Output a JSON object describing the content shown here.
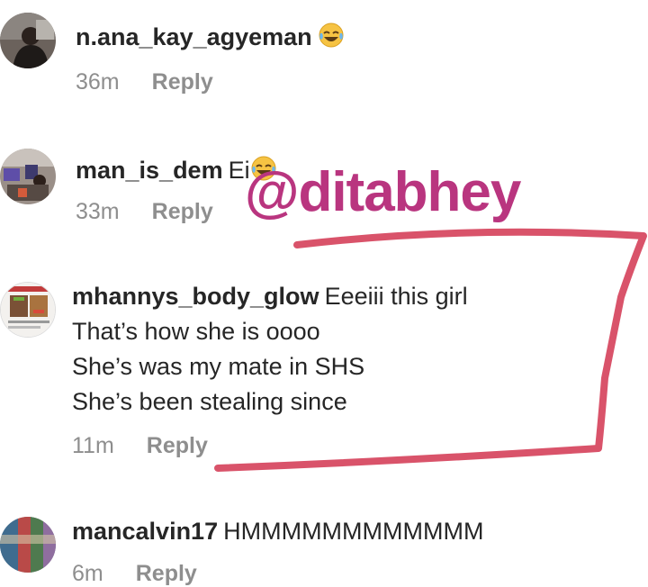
{
  "comments": [
    {
      "username": "n.ana_kay_agyeman",
      "text": "",
      "emoji": "laughing-crying-emoji",
      "time": "36m",
      "reply_label": "Reply"
    },
    {
      "username": "man_is_dem",
      "text": "Ei",
      "emoji": "laughing-crying-emoji",
      "time": "33m",
      "reply_label": "Reply"
    },
    {
      "username": "mhannys_body_glow",
      "text_lines": [
        "Eeeiii this girl",
        "That’s how she is oooo",
        "She’s was my mate in SHS",
        "She’s been stealing since"
      ],
      "time": "11m",
      "reply_label": "Reply"
    },
    {
      "username": "mancalvin17",
      "text": "HMMMMMMMMMMMM",
      "time": "6m",
      "reply_label": "Reply"
    }
  ],
  "watermark": "@ditabhey",
  "colors": {
    "watermark": "#b9357f",
    "annotation_stroke": "#d9536a",
    "meta_text": "#8e8e8e"
  }
}
